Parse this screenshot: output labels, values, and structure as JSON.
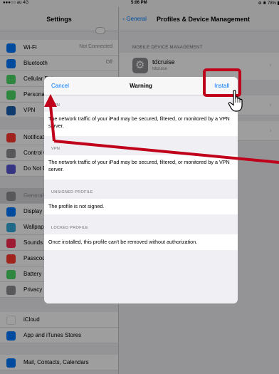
{
  "status": {
    "carrier": "●●●○○ au 4G",
    "time": "5:06 PM",
    "right": "⊕ ✱ 78%"
  },
  "master": {
    "title": "Settings",
    "items": [
      {
        "label": "Wi-Fi",
        "value": "Not Connected",
        "color": "#007aff"
      },
      {
        "label": "Bluetooth",
        "value": "Off",
        "color": "#007aff"
      },
      {
        "label": "Cellular Data",
        "value": "",
        "color": "#4cd964"
      },
      {
        "label": "Personal Hotspot",
        "value": "",
        "color": "#4cd964"
      },
      {
        "label": "VPN",
        "value": "",
        "color": "#1a5fb4"
      },
      {
        "label": "Notifications",
        "value": "",
        "color": "#ff3b30"
      },
      {
        "label": "Control Center",
        "value": "",
        "color": "#8e8e93"
      },
      {
        "label": "Do Not Disturb",
        "value": "",
        "color": "#5856d6"
      },
      {
        "label": "General",
        "value": "",
        "color": "#8e8e93"
      },
      {
        "label": "Display & Brightness",
        "value": "",
        "color": "#007aff"
      },
      {
        "label": "Wallpaper",
        "value": "",
        "color": "#34aadc"
      },
      {
        "label": "Sounds",
        "value": "",
        "color": "#ff2d55"
      },
      {
        "label": "Passcode",
        "value": "",
        "color": "#ff3b30"
      },
      {
        "label": "Battery",
        "value": "",
        "color": "#4cd964"
      },
      {
        "label": "Privacy",
        "value": "",
        "color": "#8e8e93"
      },
      {
        "label": "iCloud",
        "value": "",
        "color": "#ffffff"
      },
      {
        "label": "App and iTunes Stores",
        "value": "",
        "color": "#007aff"
      },
      {
        "label": "Mail, Contacts, Calendars",
        "value": "",
        "color": "#007aff"
      }
    ]
  },
  "detail": {
    "back_label": "General",
    "title": "Profiles & Device Management",
    "section": "MOBILE DEVICE MANAGEMENT",
    "profile_name": "tdcruise",
    "profile_sub": "tdcruise"
  },
  "modal": {
    "cancel": "Cancel",
    "title": "Warning",
    "install": "Install",
    "sections": [
      {
        "head": "VPN",
        "text": "The network traffic of your iPad may be secured, filtered, or monitored by a VPN server."
      },
      {
        "head": "VPN",
        "text": "The network traffic of your iPad may be secured, filtered, or monitored by a VPN server."
      },
      {
        "head": "UNSIGNED PROFILE",
        "text": "The profile is not signed."
      },
      {
        "head": "LOCKED PROFILE",
        "text": "Once installed, this profile can't be removed without authorization."
      }
    ]
  },
  "colors": {
    "accent": "#007aff",
    "annotation": "#c0001a"
  }
}
